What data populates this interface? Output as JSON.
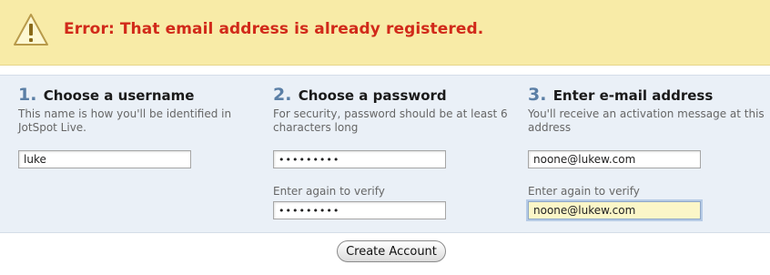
{
  "error": {
    "message": "Error: That email address is already registered.",
    "icon": "warning-triangle-icon"
  },
  "steps": [
    {
      "number": "1.",
      "title": "Choose a username",
      "description": "This name is how you'll be identified in JotSpot Live.",
      "field_value": "luke"
    },
    {
      "number": "2.",
      "title": "Choose a password",
      "description": "For security, password should be at least 6 characters long",
      "field_value": "•••••••••",
      "verify_label": "Enter again to verify",
      "verify_value": "•••••••••"
    },
    {
      "number": "3.",
      "title": "Enter e-mail address",
      "description": "You'll receive an activation message at this address",
      "field_value": "noone@lukew.com",
      "verify_label": "Enter again to verify",
      "verify_value": "noone@lukew.com"
    }
  ],
  "submit_label": "Create Account",
  "colors": {
    "error_text": "#d12a1a",
    "banner_bg": "#f8eba7",
    "panel_bg": "#eaf0f7",
    "step_number": "#5b7fa6"
  }
}
